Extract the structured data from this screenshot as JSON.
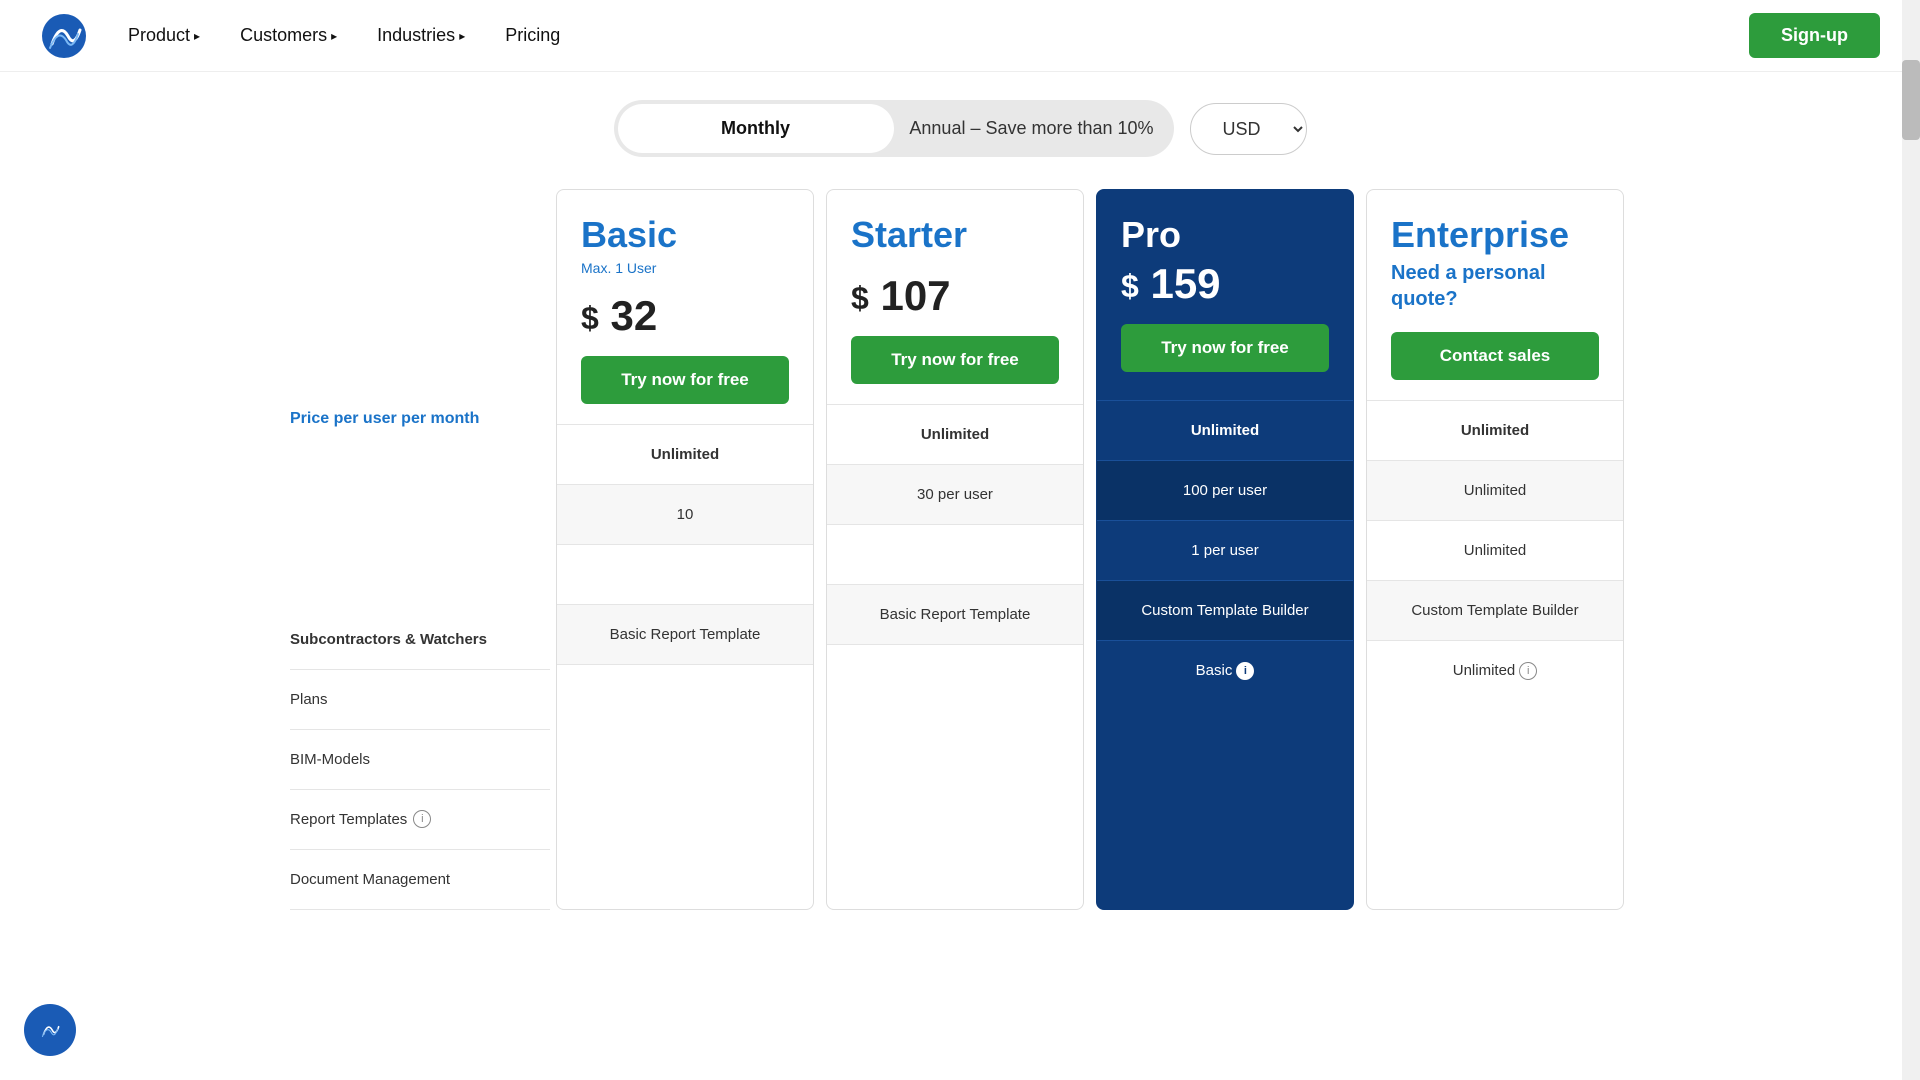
{
  "nav": {
    "product_label": "Product",
    "customers_label": "Customers",
    "industries_label": "Industries",
    "pricing_label": "Pricing",
    "signup_label": "Sign-up"
  },
  "billing": {
    "monthly_label": "Monthly",
    "annual_label": "Annual – Save more than 10%",
    "currency_label": "USD",
    "active": "monthly"
  },
  "labels": {
    "price_per_user": "Price per user per month",
    "subcontractors": "Subcontractors & Watchers",
    "plans": "Plans",
    "bim_models": "BIM-Models",
    "report_templates": "Report Templates",
    "document_management": "Document Management"
  },
  "plans": [
    {
      "id": "basic",
      "name": "Basic",
      "subtitle": "Max. 1 User",
      "price": "32",
      "cta_label": "Try now for free",
      "subcontractors": "Unlimited",
      "plans_val": "10",
      "bim_models": "",
      "report_templates": "Basic Report Template",
      "document_management": ""
    },
    {
      "id": "starter",
      "name": "Starter",
      "subtitle": "",
      "price": "107",
      "cta_label": "Try now for free",
      "subcontractors": "Unlimited",
      "plans_val": "30 per user",
      "bim_models": "",
      "report_templates": "Basic Report Template",
      "document_management": ""
    },
    {
      "id": "pro",
      "name": "Pro",
      "subtitle": "",
      "price": "159",
      "cta_label": "Try now for free",
      "subcontractors": "Unlimited",
      "plans_val": "100 per user",
      "bim_models": "1 per user",
      "report_templates": "Custom Template Builder",
      "document_management": "Basic"
    },
    {
      "id": "enterprise",
      "name": "Enterprise",
      "subtitle": "",
      "price": "",
      "quote": "Need a personal quote?",
      "cta_label": "Contact sales",
      "subcontractors": "Unlimited",
      "plans_val": "Unlimited",
      "bim_models": "Unlimited",
      "report_templates": "Custom Template Builder",
      "document_management": "Unlimited"
    }
  ]
}
